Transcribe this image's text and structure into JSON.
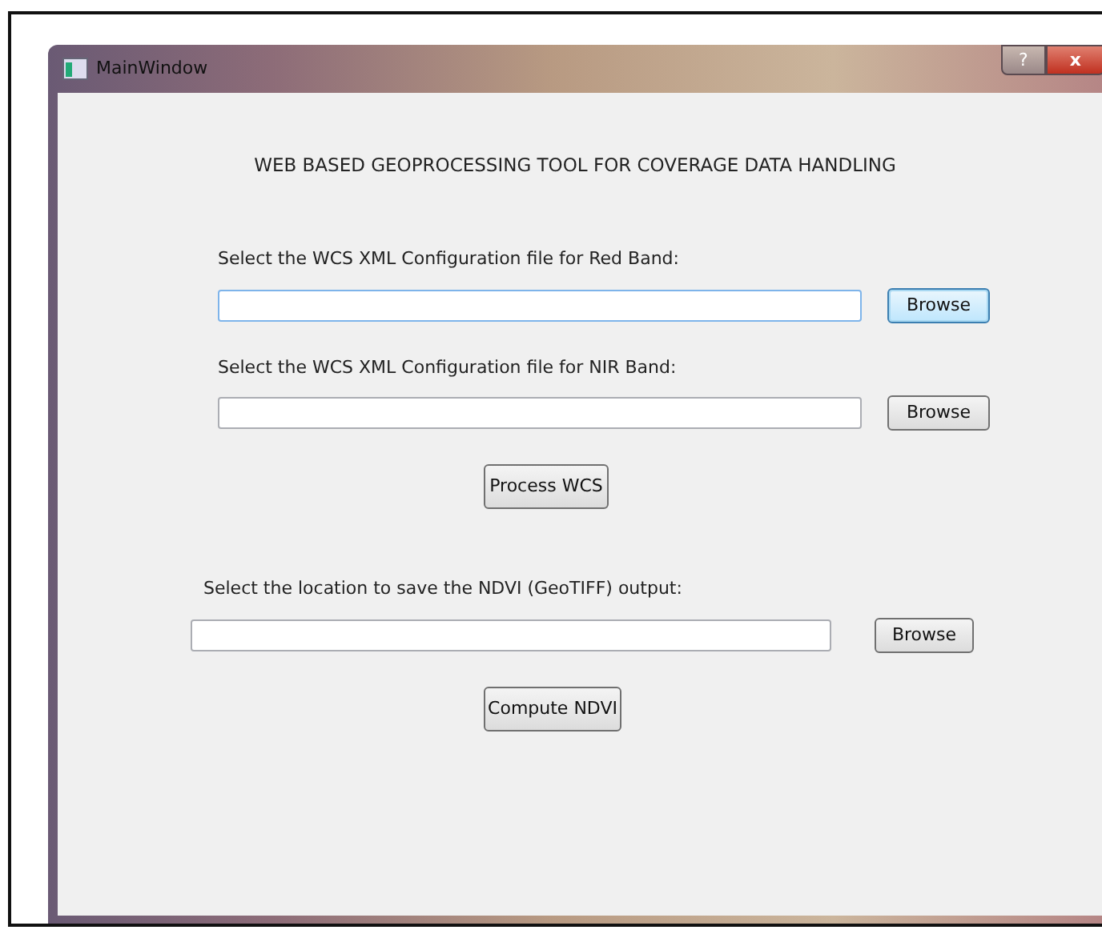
{
  "window": {
    "title": "MainWindow",
    "help_button": "?",
    "close_button": "x"
  },
  "heading": "WEB BASED GEOPROCESSING TOOL FOR COVERAGE DATA HANDLING",
  "file_rows": [
    {
      "label": "Select the WCS XML Configuration file for Red Band:",
      "focused": true,
      "button": "Browse",
      "button_focused": true
    },
    {
      "label": "Select the WCS XML Configuration file for NIR Band:",
      "focused": false,
      "button": "Browse",
      "button_focused": false
    }
  ],
  "process_button": "Process WCS",
  "output_row": {
    "label": "Select the location to save the NDVI (GeoTIFF) output:",
    "focused": false,
    "button": "Browse",
    "button_focused": false
  },
  "compute_button": "Compute NDVI"
}
